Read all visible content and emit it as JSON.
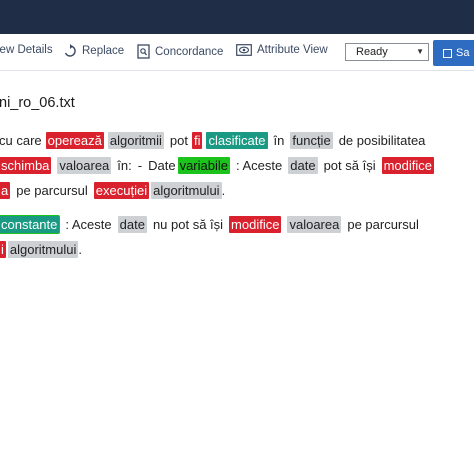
{
  "toolbar": {
    "view_details": "iew Details",
    "replace": "Replace",
    "concordance": "Concordance",
    "attribute_view": "Attribute View",
    "status_select": "Ready",
    "save": "Sa"
  },
  "document": {
    "title": "ni_ro_06.txt",
    "lines": [
      [
        {
          "t": "cu care",
          "s": "plain"
        },
        {
          "t": "operează",
          "s": "red"
        },
        {
          "t": "algoritmii",
          "s": "gray"
        },
        {
          "t": "pot",
          "s": "plain"
        },
        {
          "t": "fi",
          "s": "red"
        },
        {
          "t": "clasificate",
          "s": "teal"
        },
        {
          "t": "în",
          "s": "plain"
        },
        {
          "t": "funcție",
          "s": "gray"
        },
        {
          "t": "de posibilitatea",
          "s": "plain"
        }
      ],
      [
        {
          "t": "schimba",
          "s": "red"
        },
        {
          "t": "valoarea",
          "s": "gray"
        },
        {
          "t": "în:",
          "s": "plain"
        },
        {
          "t": "-",
          "s": "plain"
        },
        {
          "t": "Date",
          "s": "plain"
        },
        {
          "t": "variabile",
          "s": "green"
        },
        {
          "t": ": Aceste",
          "s": "plain"
        },
        {
          "t": "date",
          "s": "gray"
        },
        {
          "t": "pot să își",
          "s": "plain"
        },
        {
          "t": "modifice",
          "s": "red"
        }
      ],
      [
        {
          "t": "a",
          "s": "red"
        },
        {
          "t": "pe parcursul",
          "s": "plain"
        },
        {
          "t": "execuției",
          "s": "red"
        },
        {
          "t": "algoritmului",
          "s": "gray"
        },
        {
          "t": ".",
          "s": "plain"
        }
      ],
      [
        {
          "t": "constante",
          "s": "outline"
        },
        {
          "t": ": Aceste",
          "s": "plain"
        },
        {
          "t": "date",
          "s": "gray"
        },
        {
          "t": "nu pot să își",
          "s": "plain"
        },
        {
          "t": "modifice",
          "s": "red"
        },
        {
          "t": "valoarea",
          "s": "gray"
        },
        {
          "t": "pe parcursul",
          "s": "plain"
        }
      ],
      [
        {
          "t": "i",
          "s": "red"
        },
        {
          "t": "algoritmului",
          "s": "gray"
        },
        {
          "t": ".",
          "s": "plain"
        }
      ]
    ]
  },
  "colors": {
    "topbar": "#1f2d47",
    "annotation_red": "#d9222e",
    "annotation_gray": "#cdd1d4",
    "annotation_teal": "#1a9a82",
    "annotation_green": "#1cc31c",
    "save_button": "#2d6cc0"
  }
}
